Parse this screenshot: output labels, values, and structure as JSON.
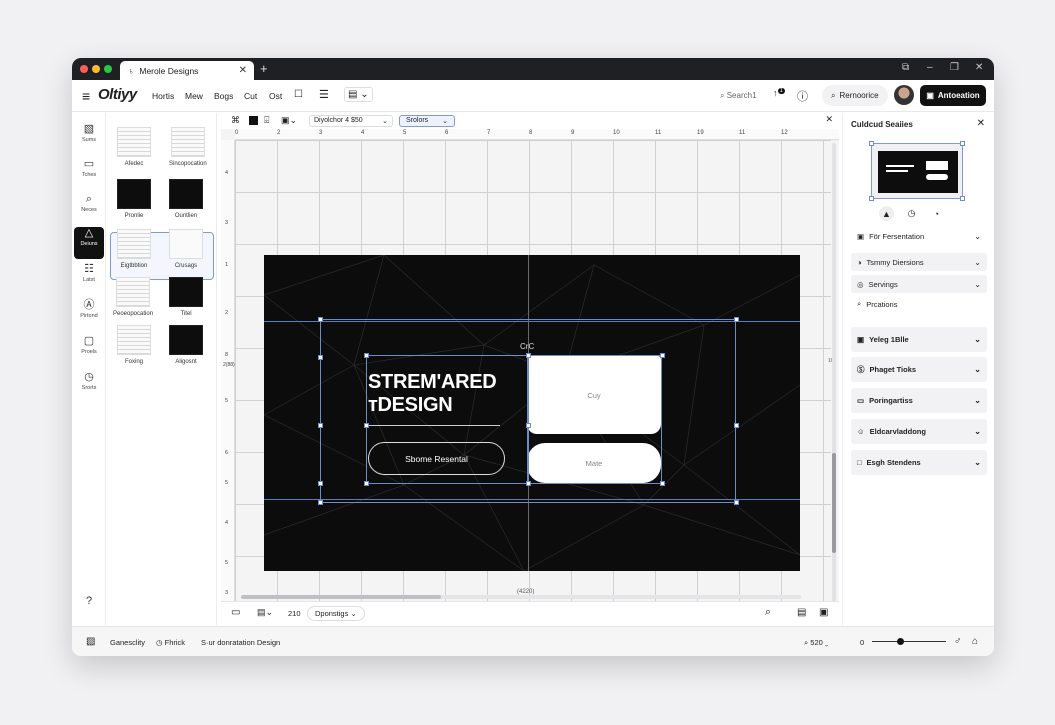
{
  "tab": {
    "title": "Merole Designs"
  },
  "toolbar": {
    "logo": "Oltiyy",
    "menu": [
      "Hortis",
      "Mew",
      "Bogs",
      "Cut",
      "Ost"
    ],
    "search_label": "Search1",
    "badge": "1",
    "pill_label": "Rernoorice",
    "primary_button": "Antoeation"
  },
  "rail": {
    "items": [
      {
        "label": "Sums",
        "icon": "layout-icon"
      },
      {
        "label": "Tches",
        "icon": "comment-icon"
      },
      {
        "label": "Neces",
        "icon": "search-icon"
      },
      {
        "label": "Deiuns",
        "icon": "triangle-icon"
      },
      {
        "label": "Latst",
        "icon": "grid-icon"
      },
      {
        "label": "Pirtond",
        "icon": "circle-a-icon"
      },
      {
        "label": "Proels",
        "icon": "box-icon"
      },
      {
        "label": "Srorts",
        "icon": "timer-icon"
      }
    ]
  },
  "thumbs": [
    {
      "label": "Afedec"
    },
    {
      "label": "Sincopocation"
    },
    {
      "label": "Pronlie"
    },
    {
      "label": "Ountlien"
    },
    {
      "label": "Eigtbbtion"
    },
    {
      "label": "Crusags"
    },
    {
      "label": "Peoeopocation"
    },
    {
      "label": "Titel"
    },
    {
      "label": "Foxing"
    },
    {
      "label": "Aligosnt"
    }
  ],
  "canvas": {
    "zoom_select": "Diyolchor 4 $50",
    "mode_select": "Srolors",
    "ruler_top": [
      "0",
      "2",
      "3",
      "4",
      "5",
      "6",
      "7",
      "8",
      "9",
      "10",
      "11",
      "19",
      "11",
      "12"
    ],
    "ruler_left": [
      "4",
      "3",
      "1",
      "2",
      "8",
      "5",
      "6",
      "5",
      "4",
      "5",
      "3"
    ],
    "ruler_side_note": "2(88)",
    "ruler_right_note": "10",
    "ruler_bottom_note": "(4220)",
    "slide": {
      "title_line1": "STREM'ARED",
      "title_line2": "тDESIGN",
      "outline_button": "Sbome Resental",
      "card1": "Cuy",
      "card2": "Mate",
      "label_above": "CrC"
    },
    "bottom": {
      "page_num": "210",
      "select": "Dponstigs"
    }
  },
  "panel": {
    "title": "Culdcud Seaiies",
    "rows": [
      {
        "label": "För Fersentation",
        "style": "plain"
      },
      {
        "label": "Tsmmy Diersions",
        "style": "bg"
      },
      {
        "label": "Servings",
        "style": "bg"
      },
      {
        "label": "Prcations",
        "style": "plain"
      },
      {
        "label": "Yeleg 1Blle",
        "style": "big"
      },
      {
        "label": "Phaget Tioks",
        "style": "big"
      },
      {
        "label": "Poringartiss",
        "style": "big"
      },
      {
        "label": "Eldcarvladdong",
        "style": "big"
      },
      {
        "label": "Esgh Stendens",
        "style": "big"
      }
    ]
  },
  "statusbar": {
    "left1": "Ganesclity",
    "left2": "Fhrick",
    "left3": "S·ur donratation Design",
    "zoom": "520",
    "slider_min": "0",
    "slider_value": 0.38
  },
  "colors": {
    "accent": "#6f8dc8",
    "dark": "#0c0c0c",
    "primary": "#111111"
  }
}
